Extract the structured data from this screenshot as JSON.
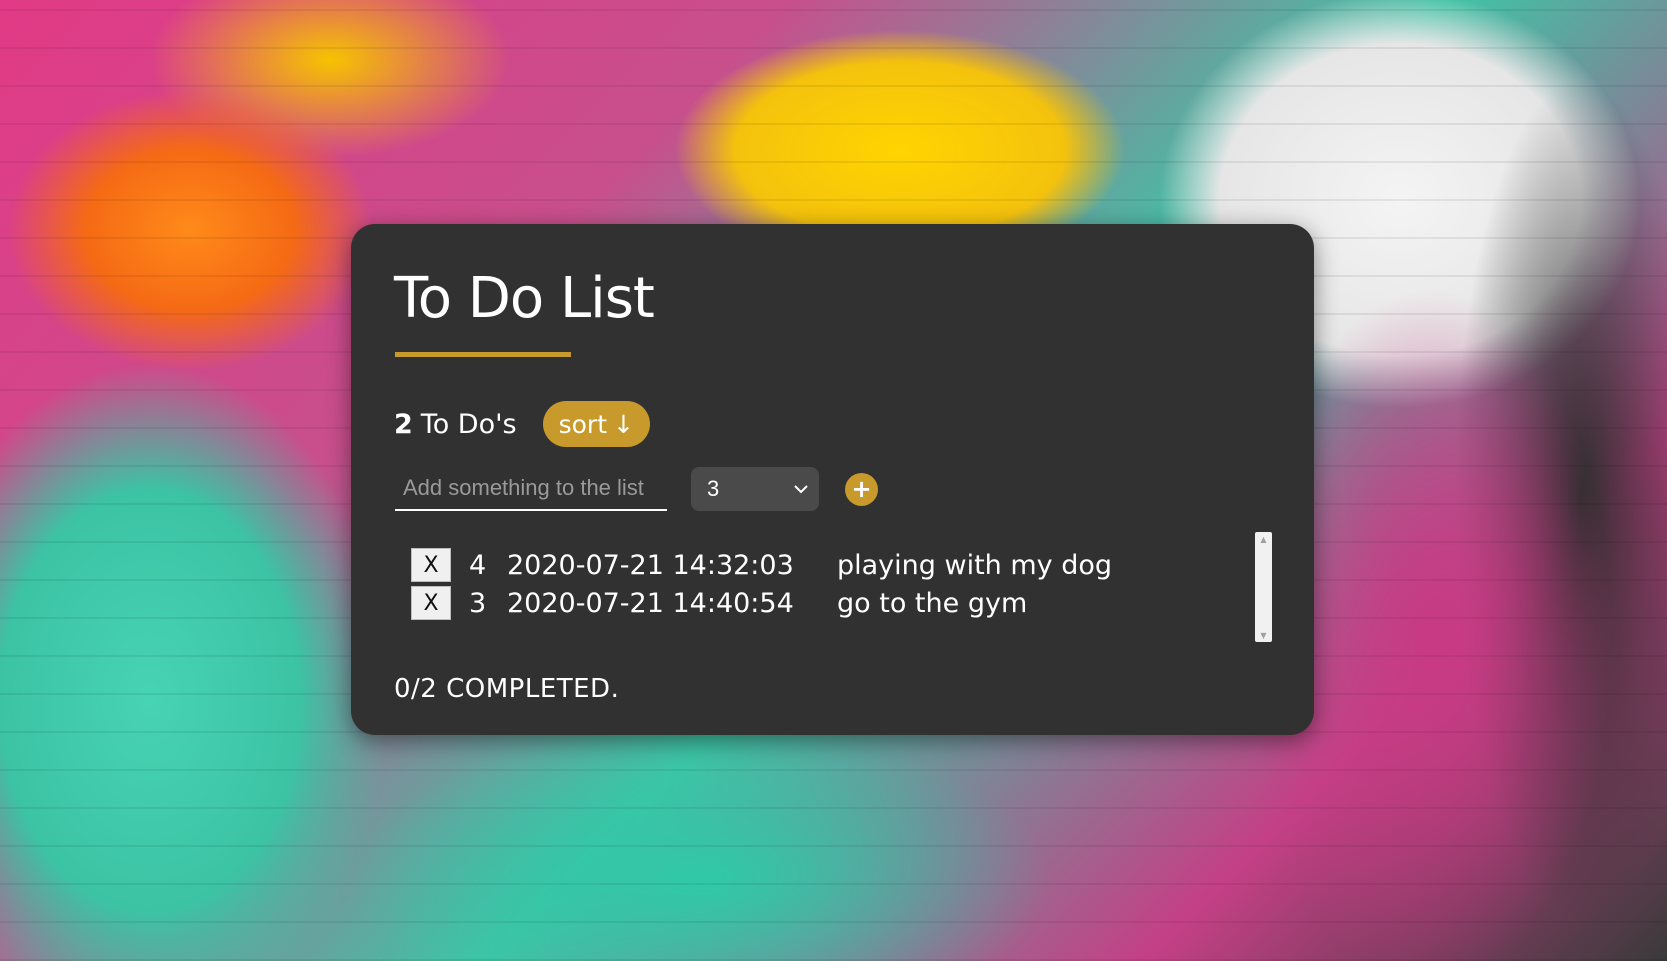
{
  "app": {
    "title": "To Do List"
  },
  "summary": {
    "count": "2",
    "count_label": "To Do's",
    "sort_label": "sort",
    "sort_arrow": "↓"
  },
  "form": {
    "input_value": "",
    "input_placeholder": "Add something to the list",
    "priority_selected": "3",
    "add_label": "+"
  },
  "todos": [
    {
      "delete_label": "X",
      "priority": "4",
      "date": "2020-07-21 14:32:03",
      "text": "playing with my dog"
    },
    {
      "delete_label": "X",
      "priority": "3",
      "date": "2020-07-21 14:40:54",
      "text": "go to the gym"
    }
  ],
  "footer": {
    "completed_text": "0/2 COMPLETED."
  },
  "colors": {
    "accent": "#c89a2b",
    "card_bg": "#313131"
  },
  "icons": {
    "select_arrow": "chevron-down-icon",
    "add": "plus-icon",
    "sort": "arrow-down-icon"
  }
}
